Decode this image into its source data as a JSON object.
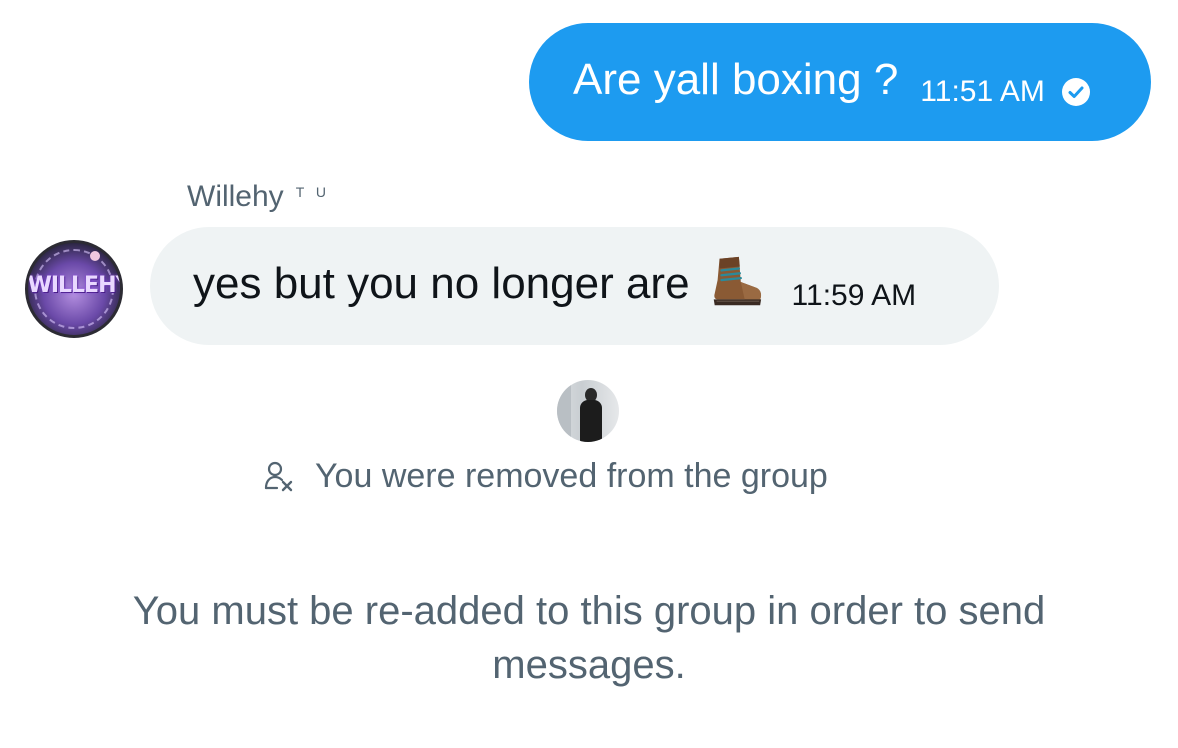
{
  "colors": {
    "outgoing_bubble": "#1d9bf0",
    "incoming_bubble": "#eff3f4",
    "secondary_text": "#536471",
    "primary_text": "#0f1419"
  },
  "messages": {
    "outgoing": {
      "text": "Are yall boxing ?",
      "time": "11:51 AM",
      "status_icon": "sent-check-icon"
    },
    "incoming": {
      "sender_name": "Willehy",
      "sender_badge": "T U",
      "avatar_text": "WILLEHY",
      "text": "yes but you no longer are",
      "emoji": "hiking-boot-icon",
      "time": "11:59 AM"
    }
  },
  "event": {
    "icon": "user-remove-icon",
    "text": "You were removed from the group"
  },
  "footer": {
    "text": "You must be re-added to this group in order to send messages."
  }
}
